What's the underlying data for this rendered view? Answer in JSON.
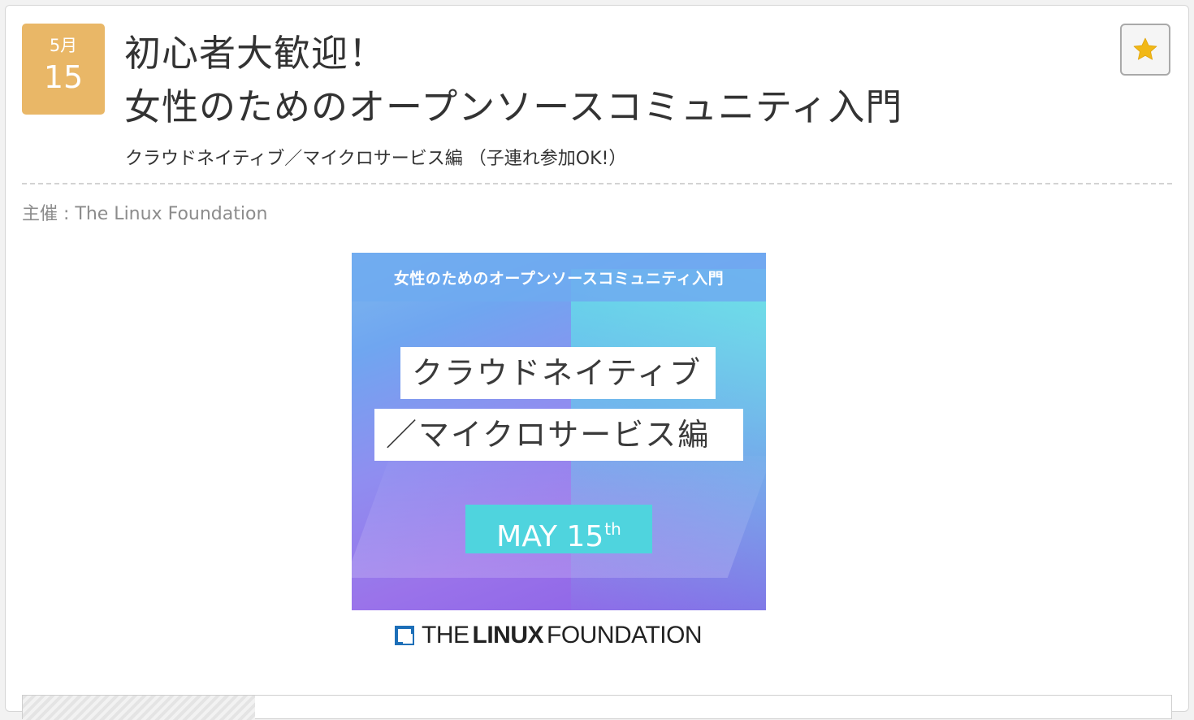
{
  "event": {
    "month": "5月",
    "day": "15",
    "title_line1": "初心者大歓迎！",
    "title_line2": "女性のためのオープンソースコミュニティ入門",
    "subtitle": "クラウドネイティブ／マイクロサービス編 （子連れ参加OK!）",
    "organizer": "主催 : The Linux Foundation",
    "favorite_icon": "star-icon"
  },
  "banner": {
    "header": "女性のためのオープンソースコミュニティ入門",
    "line1": "クラウドネイティブ",
    "line2": "／マイクロサービス編",
    "date_main": "MAY 15",
    "date_sup": "th",
    "logo_the": "THE",
    "logo_linux": "LINUX",
    "logo_foundation": "FOUNDATION"
  },
  "colors": {
    "date_badge": "#e9b767",
    "star": "#f1b817",
    "banner_date_bg": "#4fd4de"
  }
}
